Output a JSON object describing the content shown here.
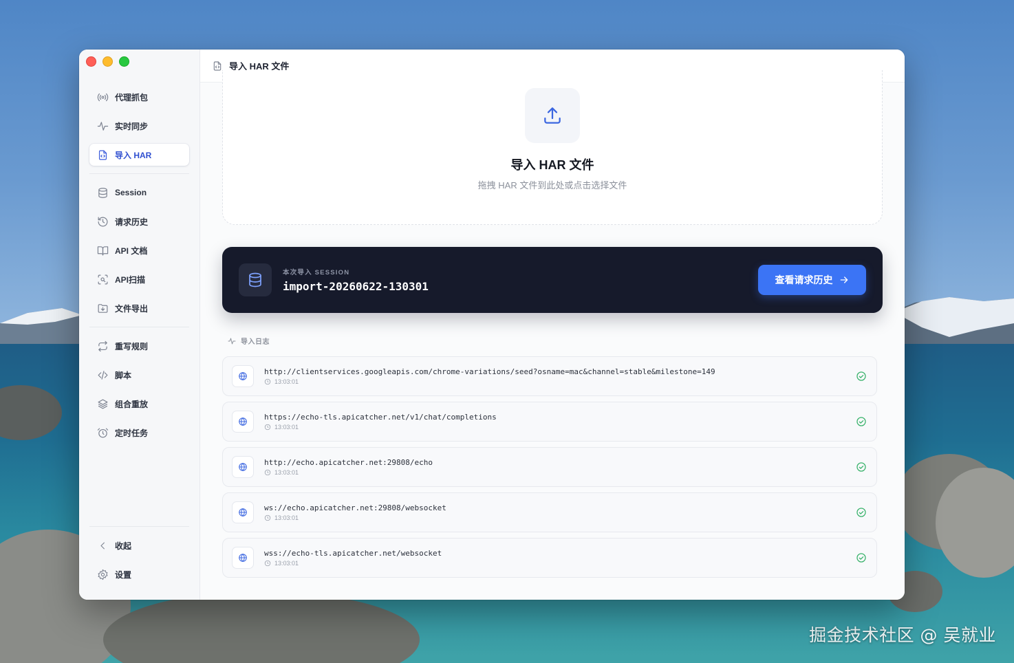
{
  "window": {
    "title": "导入 HAR 文件"
  },
  "sidebar": {
    "items": [
      {
        "label": "代理抓包",
        "icon": "broadcast-icon"
      },
      {
        "label": "实时同步",
        "icon": "activity-icon"
      },
      {
        "label": "导入 HAR",
        "icon": "file-code-icon",
        "active": true
      },
      {
        "label": "Session",
        "icon": "database-icon"
      },
      {
        "label": "请求历史",
        "icon": "history-icon"
      },
      {
        "label": "API 文档",
        "icon": "book-icon"
      },
      {
        "label": "API扫描",
        "icon": "scan-icon"
      },
      {
        "label": "文件导出",
        "icon": "folder-export-icon"
      },
      {
        "label": "重写规则",
        "icon": "repeat-icon"
      },
      {
        "label": "脚本",
        "icon": "code-icon"
      },
      {
        "label": "组合重放",
        "icon": "layers-icon"
      },
      {
        "label": "定时任务",
        "icon": "alarm-icon"
      }
    ],
    "footer": {
      "collapse_label": "收起",
      "settings_label": "设置"
    }
  },
  "dropzone": {
    "title": "导入 HAR 文件",
    "subtitle": "拖拽 HAR 文件到此处或点击选择文件"
  },
  "session": {
    "kicker": "本次导入 SESSION",
    "name": "import-20260622-130301",
    "button_label": "查看请求历史"
  },
  "log": {
    "header": "导入日志",
    "entries": [
      {
        "url": "http://clientservices.googleapis.com/chrome-variations/seed?osname=mac&channel=stable&milestone=149",
        "time": "13:03:01",
        "status": "success"
      },
      {
        "url": "https://echo-tls.apicatcher.net/v1/chat/completions",
        "time": "13:03:01",
        "status": "success"
      },
      {
        "url": "http://echo.apicatcher.net:29808/echo",
        "time": "13:03:01",
        "status": "success"
      },
      {
        "url": "ws://echo.apicatcher.net:29808/websocket",
        "time": "13:03:01",
        "status": "success"
      },
      {
        "url": "wss://echo-tls.apicatcher.net/websocket",
        "time": "13:03:01",
        "status": "success"
      }
    ]
  },
  "desktop": {
    "watermark": "掘金技术社区 @ 吴就业"
  },
  "colors": {
    "accent": "#3b74f5",
    "active_nav_text": "#2f4fd0",
    "session_card_bg": "#161a2b",
    "success": "#38b26a"
  }
}
